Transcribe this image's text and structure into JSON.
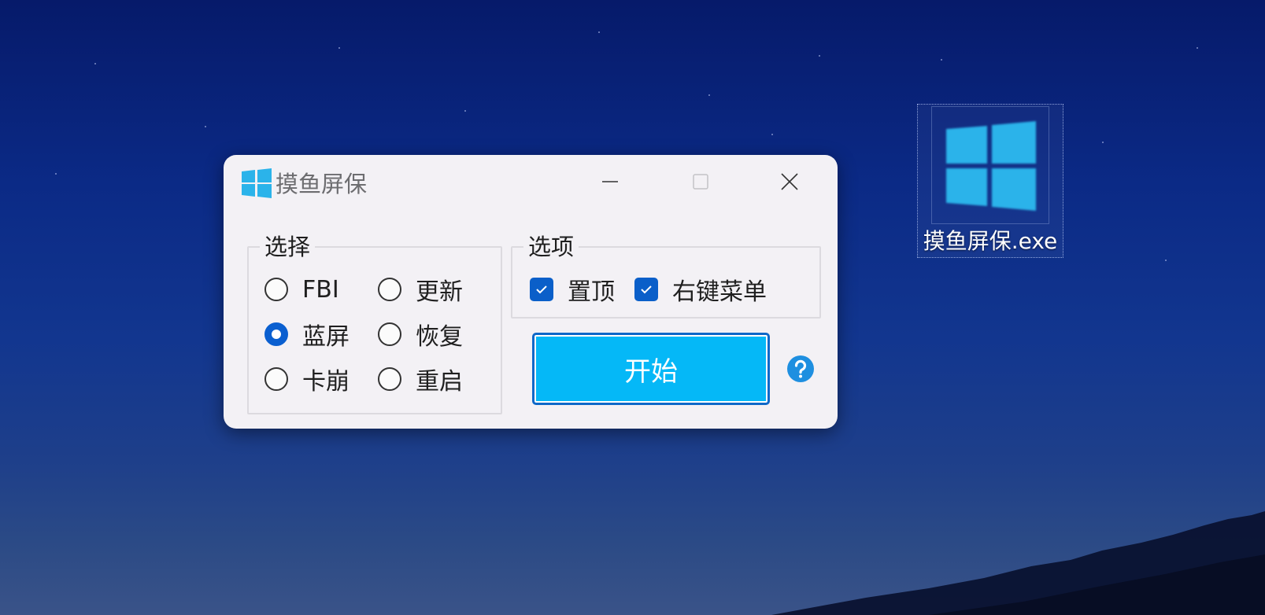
{
  "desktop": {
    "icon_label": "摸鱼屏保.exe"
  },
  "window": {
    "title": "摸鱼屏保",
    "select_group": {
      "legend": "选择",
      "radios": [
        {
          "label": "FBI",
          "checked": false
        },
        {
          "label": "更新",
          "checked": false
        },
        {
          "label": "蓝屏",
          "checked": true
        },
        {
          "label": "恢复",
          "checked": false
        },
        {
          "label": "卡崩",
          "checked": false
        },
        {
          "label": "重启",
          "checked": false
        }
      ]
    },
    "options_group": {
      "legend": "选项",
      "checkboxes": [
        {
          "label": "置顶",
          "checked": true
        },
        {
          "label": "右键菜单",
          "checked": true
        }
      ]
    },
    "start_label": "开始"
  },
  "colors": {
    "accent": "#0a5fc9",
    "start_button": "#05b8f7",
    "windows_logo": "#2bb3ea"
  },
  "icons": [
    "windows-logo-icon",
    "minimize-icon",
    "maximize-icon",
    "close-icon",
    "checkmark-icon",
    "help-icon"
  ]
}
